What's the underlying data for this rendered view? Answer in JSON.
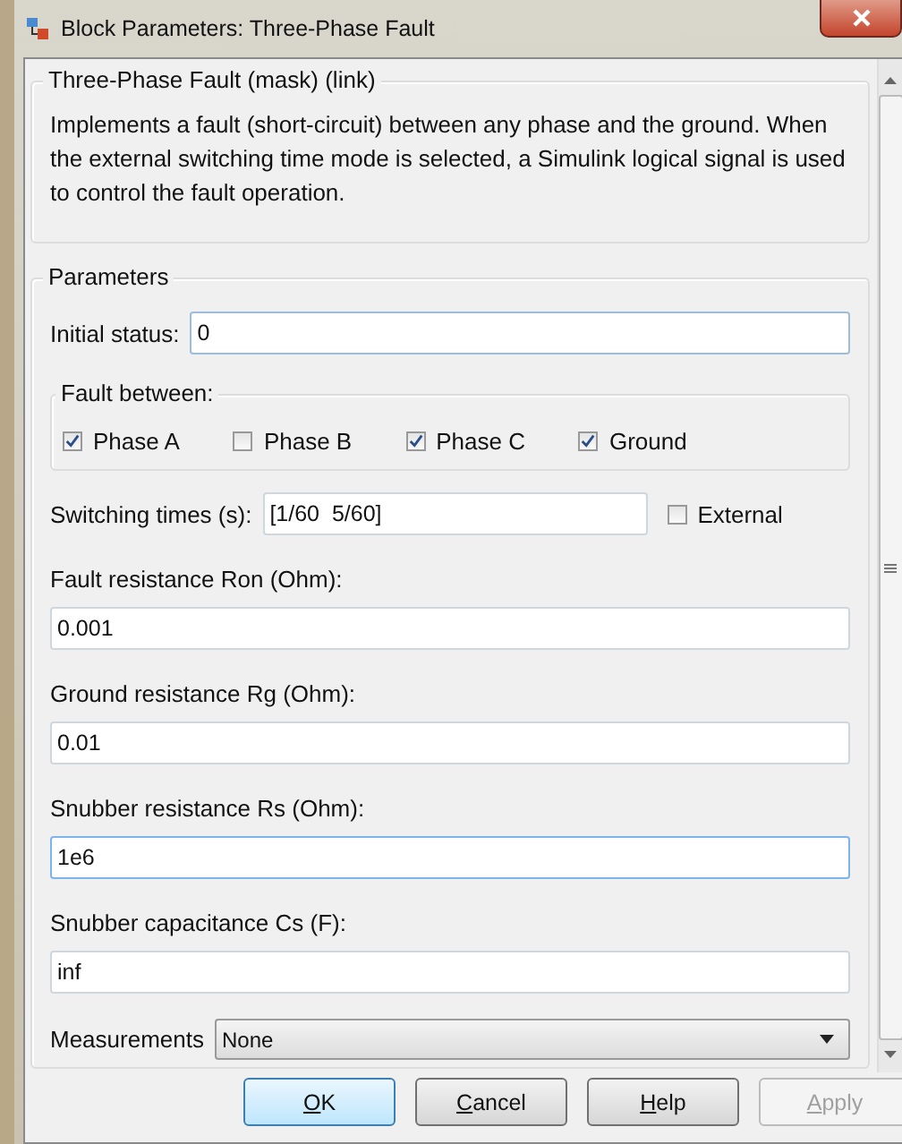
{
  "window": {
    "title": "Block Parameters: Three-Phase Fault"
  },
  "description": {
    "title": "Three-Phase Fault (mask) (link)",
    "text": "Implements a fault (short-circuit) between any phase and the ground. When the external switching time mode is selected, a Simulink logical signal is used to control the fault operation."
  },
  "parameters": {
    "title": "Parameters",
    "initial_status": {
      "label": "Initial status:",
      "value": "0"
    },
    "fault_between": {
      "title": "Fault between:",
      "options": [
        {
          "label": "Phase A",
          "checked": true
        },
        {
          "label": "Phase B",
          "checked": false
        },
        {
          "label": "Phase C",
          "checked": true
        },
        {
          "label": "Ground",
          "checked": true
        }
      ]
    },
    "switching_times": {
      "label": "Switching times (s):",
      "value": "[1/60  5/60]",
      "external": {
        "label": "External",
        "checked": false
      }
    },
    "fields": [
      {
        "label": "Fault resistance Ron (Ohm):",
        "value": "0.001",
        "focused": false
      },
      {
        "label": "Ground resistance Rg (Ohm):",
        "value": "0.01",
        "focused": false
      },
      {
        "label": "Snubber resistance Rs (Ohm):",
        "value": "1e6",
        "focused": true
      },
      {
        "label": "Snubber capacitance Cs (F):",
        "value": "inf",
        "focused": false
      }
    ],
    "measurements": {
      "label": "Measurements",
      "value": "None"
    }
  },
  "buttons": [
    {
      "label": "OK",
      "default": true,
      "disabled": false
    },
    {
      "label": "Cancel",
      "default": false,
      "disabled": false
    },
    {
      "label": "Help",
      "default": false,
      "disabled": false
    },
    {
      "label": "Apply",
      "default": false,
      "disabled": true
    }
  ]
}
